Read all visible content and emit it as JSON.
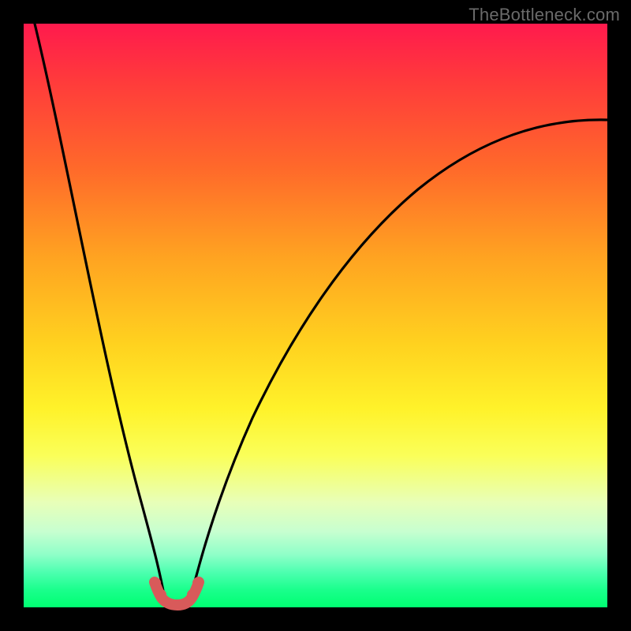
{
  "watermark": {
    "text": "TheBottleneck.com"
  },
  "chart_data": {
    "type": "line",
    "title": "",
    "xlabel": "",
    "ylabel": "",
    "xlim": [
      0,
      100
    ],
    "ylim": [
      0,
      100
    ],
    "grid": false,
    "legend": false,
    "background_gradient": {
      "stops": [
        {
          "pos": 0,
          "color": "#ff1a4d"
        },
        {
          "pos": 25,
          "color": "#ff6a2a"
        },
        {
          "pos": 55,
          "color": "#ffd21f"
        },
        {
          "pos": 74,
          "color": "#faff59"
        },
        {
          "pos": 91,
          "color": "#8effc8"
        },
        {
          "pos": 100,
          "color": "#00ff72"
        }
      ]
    },
    "series": [
      {
        "name": "left-branch",
        "color": "#000000",
        "x": [
          2,
          4,
          6,
          8,
          10,
          12,
          14,
          16,
          18,
          20,
          21,
          22,
          23,
          24
        ],
        "y": [
          100,
          90,
          80,
          70,
          60,
          50,
          41,
          32,
          23,
          13,
          9,
          5,
          2,
          0
        ]
      },
      {
        "name": "right-branch",
        "color": "#000000",
        "x": [
          28,
          29,
          30,
          32,
          34,
          37,
          40,
          45,
          50,
          55,
          60,
          66,
          73,
          80,
          88,
          96,
          100
        ],
        "y": [
          0,
          2,
          5,
          10,
          16,
          23,
          30,
          40,
          48,
          55,
          60,
          66,
          71,
          75,
          79,
          82,
          83
        ]
      },
      {
        "name": "valley-marker",
        "color": "#d85a5a",
        "x": [
          22.5,
          23,
          23.5,
          24,
          25,
          26,
          27,
          28,
          28.5,
          29,
          29.5
        ],
        "y": [
          3.6,
          2.4,
          1.4,
          0.6,
          0.2,
          0.2,
          0.6,
          1.4,
          2.4,
          3.6,
          4.8
        ]
      }
    ],
    "minimum": {
      "x": 26,
      "y": 0
    }
  }
}
